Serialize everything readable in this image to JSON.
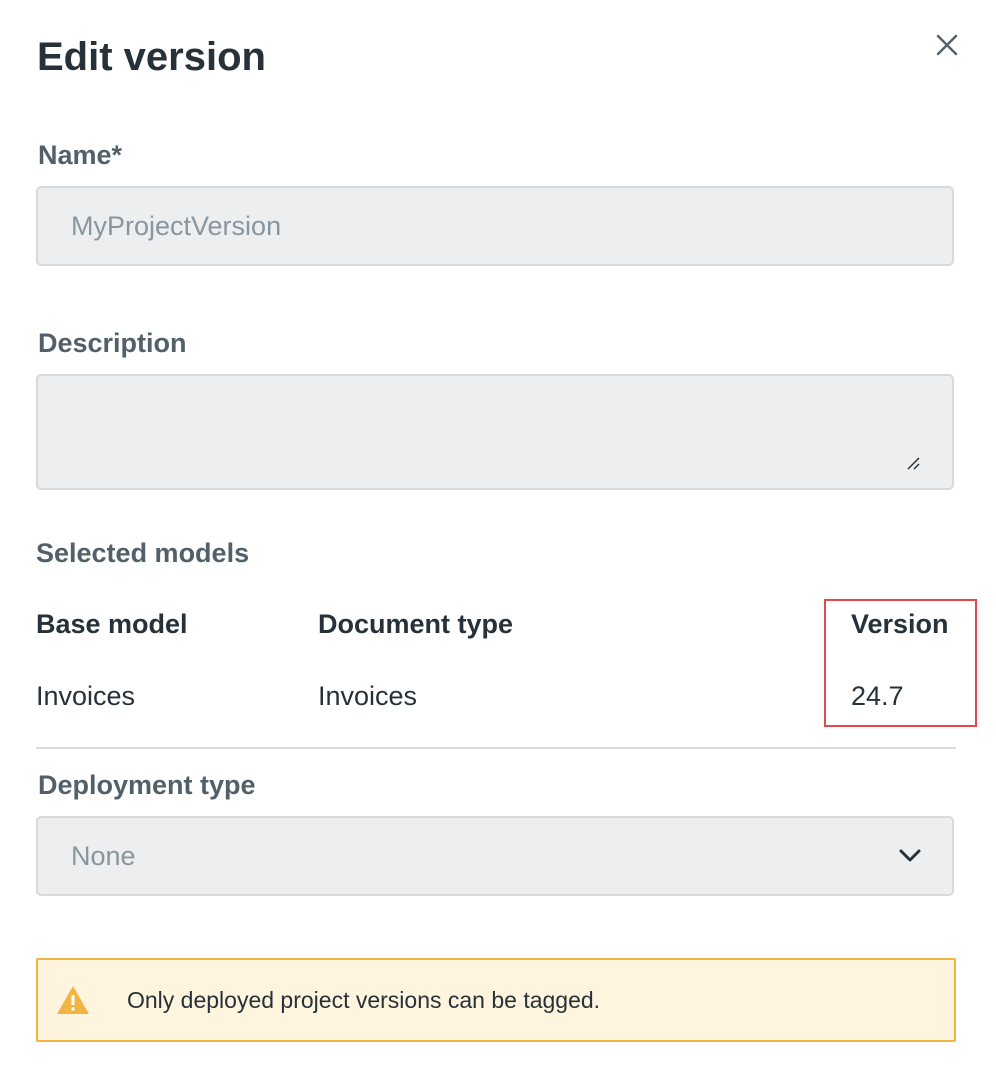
{
  "dialog": {
    "title": "Edit version",
    "close_icon": "close-icon"
  },
  "name_field": {
    "label": "Name*",
    "value": "MyProjectVersion"
  },
  "description_field": {
    "label": "Description",
    "value": "",
    "resize_icon": "resize-handle-icon"
  },
  "selected_models": {
    "label": "Selected models",
    "columns": [
      "Base model",
      "Document type",
      "Version"
    ],
    "rows": [
      [
        "Invoices",
        "Invoices",
        "24.7"
      ]
    ]
  },
  "deployment_type": {
    "label": "Deployment type",
    "selected": "None",
    "dropdown_icon": "chevron-down-icon"
  },
  "alert": {
    "text": "Only deployed project versions can be tagged.",
    "icon": "warning-icon",
    "color": "#f2b543"
  },
  "colors": {
    "highlight": "#e34948",
    "warning_bg": "#fff4dd",
    "input_bg": "#eceef0"
  }
}
